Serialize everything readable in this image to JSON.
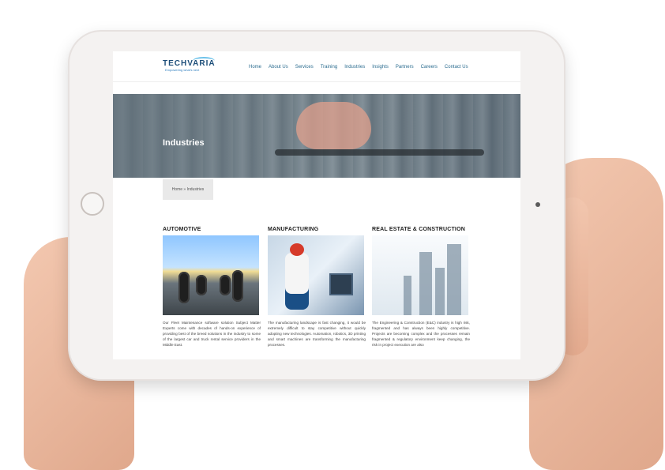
{
  "logo": {
    "name": "TECHVARIA",
    "tagline": "Empowering what's next"
  },
  "nav": [
    "Home",
    "About Us",
    "Services",
    "Training",
    "Industries",
    "Insights",
    "Partners",
    "Careers",
    "Contact Us"
  ],
  "hero": {
    "title": "Industries"
  },
  "breadcrumb": "Home » Industries",
  "columns": [
    {
      "title": "AUTOMOTIVE",
      "text": "Our Fleet Maintenance software solution Subject Matter Experts come with decades of hands-on experience of providing best of the breed solutions in the industry to some of the largest car and truck rental service providers in the Middle East."
    },
    {
      "title": "MANUFACTURING",
      "text": "The manufacturing landscape is fast changing, it would be extremely difficult to stay competitive without quickly adopting new technologies. Automation, robotics, 3D printing and smart machines are transforming the manufacturing processes."
    },
    {
      "title": "REAL ESTATE & CONSTRUCTION",
      "text": "The Engineering & Construction (E&C) industry is high risk, fragmented and has always been highly competitive. Projects are becoming complex and the processes remain fragmented & regulatory environment keep changing, the risk in project execution are also"
    }
  ],
  "colors": {
    "brand": "#1d4e79",
    "accent": "#6dc2ea",
    "nav_text": "#2b6c8f"
  }
}
